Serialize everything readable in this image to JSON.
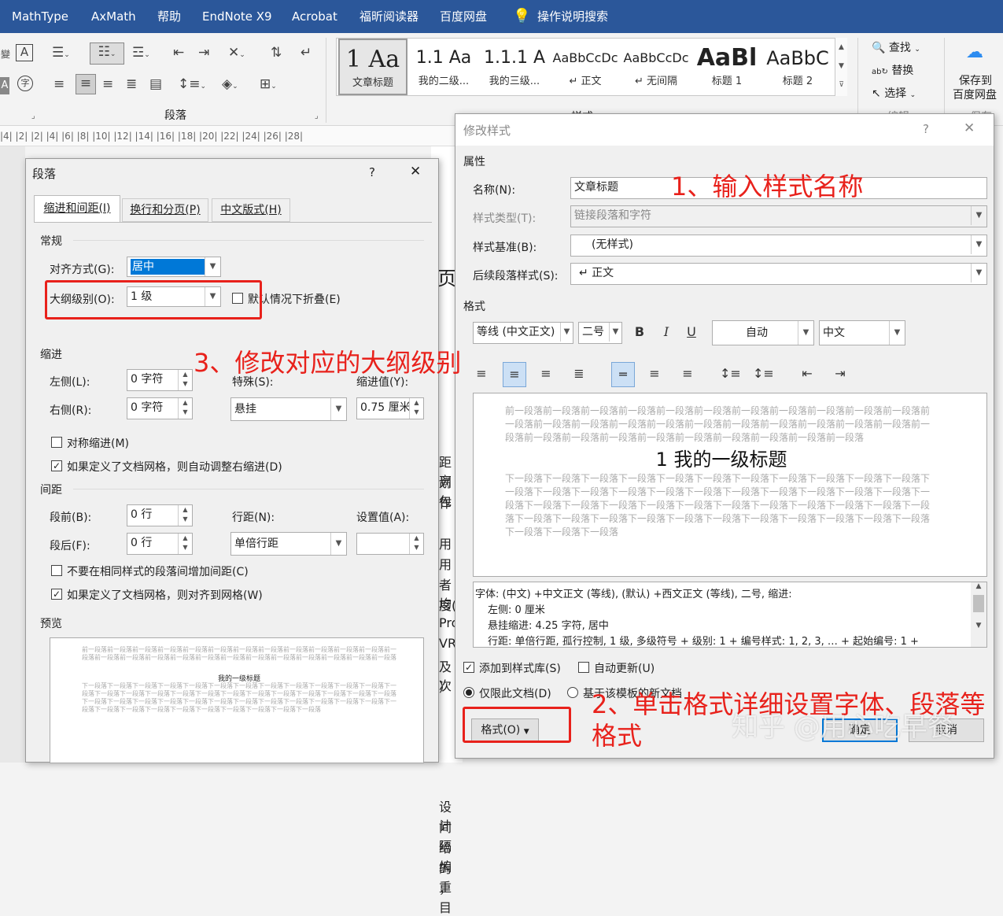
{
  "ribbon": {
    "tabs": [
      "MathType",
      "AxMath",
      "帮助",
      "EndNote X9",
      "Acrobat",
      "福昕阅读器",
      "百度网盘"
    ],
    "tell_me": "操作说明搜索",
    "paragraph_group": "段落",
    "styles_group": "样式",
    "editing_group": "编辑",
    "styles": [
      {
        "sample": "1 Aa",
        "label": "文章标题"
      },
      {
        "sample": "1.1 Aa",
        "label": "我的二级..."
      },
      {
        "sample": "1.1.1 A",
        "label": "我的三级..."
      },
      {
        "sample": "AaBbCcDc",
        "label": "↵ 正文"
      },
      {
        "sample": "AaBbCcDc",
        "label": "↵ 无间隔"
      },
      {
        "sample": "AaBl",
        "label": "标题 1"
      },
      {
        "sample": "AaBbC",
        "label": "标题 2"
      }
    ],
    "find": "查找",
    "replace": "替换",
    "select": "选择",
    "save_to": "保存到",
    "baidu_pan": "百度网盘",
    "save_partial": "保存"
  },
  "ruler": {
    "text": "|4|  |2|        |2|  |4|  |6|  |8|  |10|  |12|  |14|  |16|  |18|  |20|  |22|  |24|  |26|  |28|"
  },
  "paragraph_dialog": {
    "title": "段落",
    "help": "?",
    "close": "✕",
    "tabs": [
      "缩进和间距(I)",
      "换行和分页(P)",
      "中文版式(H)"
    ],
    "general": "常规",
    "align_label": "对齐方式(G):",
    "align_value": "居中",
    "outline_label": "大纲级别(O):",
    "outline_value": "1 级",
    "collapse_label": "默认情况下折叠(E)",
    "indent": "缩进",
    "left_label": "左侧(L):",
    "left_value": "0 字符",
    "right_label": "右侧(R):",
    "right_value": "0 字符",
    "special_label": "特殊(S):",
    "special_value": "悬挂",
    "indent_by_label": "缩进值(Y):",
    "indent_by_value": "0.75 厘米",
    "mirror_label": "对称缩进(M)",
    "auto_right_label": "如果定义了文档网格，则自动调整右缩进(D)",
    "spacing": "间距",
    "before_label": "段前(B):",
    "before_value": "0 行",
    "after_label": "段后(F):",
    "after_value": "0 行",
    "line_spacing_label": "行距(N):",
    "line_spacing_value": "单倍行距",
    "at_label": "设置值(A):",
    "at_value": "",
    "no_space_label": "不要在相同样式的段落间增加间距(C)",
    "snap_grid_label": "如果定义了文档网格，则对齐到网格(W)",
    "preview": "预览",
    "preview_prev": "前一段落前一段落前一段落前一段落前一段落前一段落前一段落前一段落前一段落前一段落前一段落前一段落前一段落前一段落前一段落前一段落前一段落前一段落前一段落前一段落前一段落前一段落前一段落前一段落前一段落",
    "preview_heading": "我的一级标题",
    "preview_next": "下一段落下一段落下一段落下一段落下一段落下一段落下一段落下一段落下一段落下一段落下一段落下一段落下一段落下一段落下一段落下一段落下一段落下一段落下一段落下一段落下一段落下一段落下一段落下一段落下一段落下一段落下一段落下一段落下一段落下一段落下一段落下一段落下一段落下一段落下一段落下一段落下一段落下一段落下一段落下一段落下一段落下一段落下一段落下一段落下一段落下一段落下一段落"
  },
  "modify_dialog": {
    "title": "修改样式",
    "help": "?",
    "close": "✕",
    "properties": "属性",
    "name_label": "名称(N):",
    "name_value": "文章标题",
    "type_label": "样式类型(T):",
    "type_value": "链接段落和字符",
    "based_label": "样式基准(B):",
    "based_value": "(无样式)",
    "next_label": "后续段落样式(S):",
    "next_value": "↵ 正文",
    "format": "格式",
    "font_value": "等线 (中文正文)",
    "size_value": "二号",
    "bold": "B",
    "italic": "I",
    "underline": "U",
    "color_value": "自动",
    "lang_value": "中文",
    "preview_prev": "前一段落前一段落前一段落前一段落前一段落前一段落前一段落前一段落前一段落前一段落前一段落前一段落前一段落前一段落前一段落前一段落前一段落前一段落前一段落前一段落前一段落前一段落前一段落前一段落前一段落前一段落前一段落前一段落前一段落前一段落前一段落前一段落",
    "preview_heading": "1  我的一级标题",
    "preview_next": "下一段落下一段落下一段落下一段落下一段落下一段落下一段落下一段落下一段落下一段落下一段落下一段落下一段落下一段落下一段落下一段落下一段落下一段落下一段落下一段落下一段落下一段落下一段落下一段落下一段落下一段落下一段落下一段落下一段落下一段落下一段落下一段落下一段落下一段落下一段落下一段落下一段落下一段落下一段落下一段落下一段落下一段落下一段落下一段落下一段落下一段落下一段落下一段落",
    "desc1": "字体: (中文) +中文正文 (等线), (默认) +西文正文 (等线), 二号, 缩进:",
    "desc2": "左侧:  0 厘米",
    "desc3": "悬挂缩进: 4.25 字符, 居中",
    "desc4": "行距: 单倍行距, 孤行控制, 1 级, 多级符号 + 级别: 1 + 编号样式: 1, 2, 3, … + 起始编号: 1 +",
    "add_gallery": "添加到样式库(S)",
    "auto_update": "自动更新(U)",
    "only_doc": "仅限此文档(D)",
    "new_docs": "基于该模板的新文档",
    "format_button": "格式(O)",
    "ok": "确定",
    "cancel": "取消"
  },
  "annotations": {
    "a1": "1、输入样式名称",
    "a2_line1": "2、单击格式详细设置字体、段落等",
    "a2_line2": "格式",
    "a3": "3、修改对应的大纲级别",
    "watermark": "知乎 @用心吃早餐"
  },
  "doc_fragments": {
    "top": [
      "页",
      "距离",
      "划包",
      "作",
      "用",
      "用",
      "者均",
      "度(",
      "Prol",
      "VRF",
      "及次",
      "）"
    ],
    "bottom": [
      "设计",
      "间隔",
      "给编",
      "的重",
      "，目"
    ]
  }
}
